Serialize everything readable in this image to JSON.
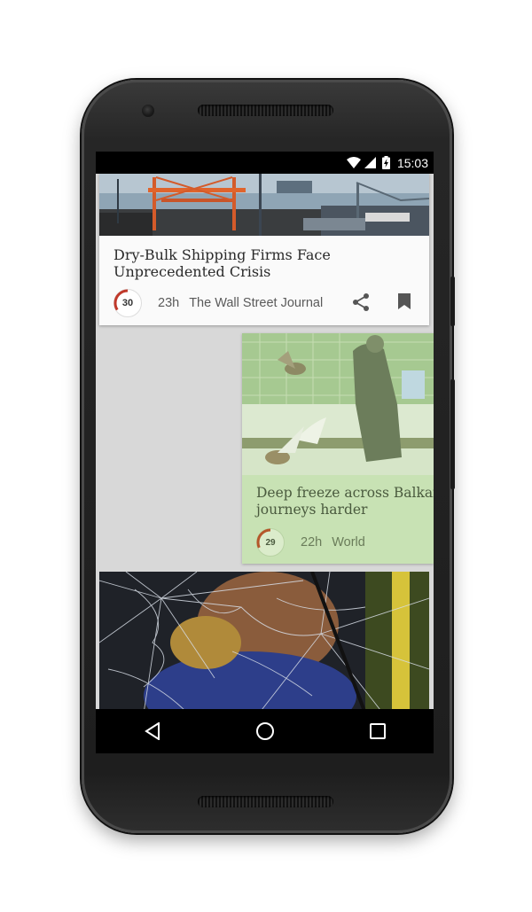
{
  "status_bar": {
    "time": "15:03",
    "icons": [
      "wifi-icon",
      "cell-signal-icon",
      "battery-charging-icon"
    ]
  },
  "feed": {
    "articles": [
      {
        "title_line1": "Dry-Bulk Shipping Firms Face",
        "title_line2": "Unprecedented Crisis",
        "score": "30",
        "age": "23h",
        "source": "The Wall Street Journal",
        "image": "industrial-port-cranes-image"
      },
      {
        "title_line1": "Deep freeze across Balkans",
        "title_line2": "journeys harder",
        "score": "29",
        "age": "22h",
        "source": "World",
        "image": "birds-feeding-snow-image",
        "card_color": "#c8e2b4"
      },
      {
        "image": "shattered-glass-image"
      }
    ]
  },
  "nav_bar": {
    "buttons": [
      "back-icon",
      "home-icon",
      "recents-icon"
    ]
  },
  "colors": {
    "score_ring": "#c0392b",
    "nav_background": "#000000",
    "feed_background": "#d8d8d8"
  }
}
